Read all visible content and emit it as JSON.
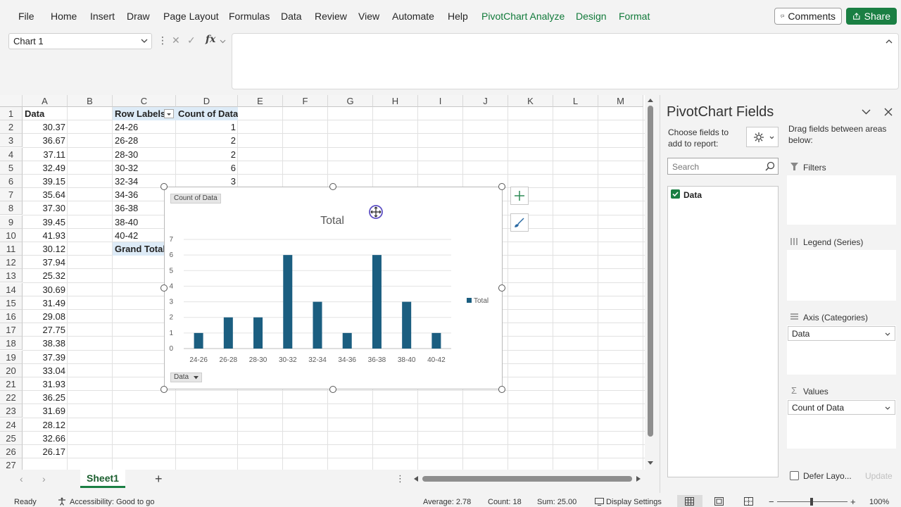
{
  "ribbon": {
    "tabs": [
      "File",
      "Home",
      "Insert",
      "Draw",
      "Page Layout",
      "Formulas",
      "Data",
      "Review",
      "View",
      "Automate",
      "Help"
    ],
    "context_tabs": [
      "PivotChart Analyze",
      "Design",
      "Format"
    ],
    "comments_label": "Comments",
    "share_label": "Share"
  },
  "formula_bar": {
    "name_box": "Chart 1",
    "fx": "fx",
    "value": ""
  },
  "grid": {
    "columns": [
      "A",
      "B",
      "C",
      "D",
      "E",
      "F",
      "G",
      "H",
      "I",
      "J",
      "K",
      "L",
      "M"
    ],
    "rows": [
      "1",
      "2",
      "3",
      "4",
      "5",
      "6",
      "7",
      "8",
      "9",
      "10",
      "11",
      "12",
      "13",
      "14",
      "15",
      "16",
      "17",
      "18",
      "19",
      "20",
      "21",
      "22",
      "23",
      "24",
      "25",
      "26",
      "27"
    ],
    "data_header": "Data",
    "data_values": [
      "30.37",
      "36.67",
      "37.11",
      "32.49",
      "39.15",
      "35.64",
      "37.30",
      "39.45",
      "41.93",
      "30.12",
      "37.94",
      "25.32",
      "30.69",
      "31.49",
      "29.08",
      "27.75",
      "38.38",
      "37.39",
      "33.04",
      "31.93",
      "36.25",
      "31.69",
      "28.12",
      "32.66",
      "26.17"
    ],
    "pivot": {
      "row_labels_header": "Row Labels",
      "count_header": "Count of Data",
      "rows": [
        {
          "label": "24-26",
          "count": "1"
        },
        {
          "label": "26-28",
          "count": "2"
        },
        {
          "label": "28-30",
          "count": "2"
        },
        {
          "label": "30-32",
          "count": "6"
        },
        {
          "label": "32-34",
          "count": "3"
        },
        {
          "label": "34-36",
          "count": ""
        },
        {
          "label": "36-38",
          "count": ""
        },
        {
          "label": "38-40",
          "count": ""
        },
        {
          "label": "40-42",
          "count": ""
        }
      ],
      "grand_total": "Grand Total"
    }
  },
  "chart_data": {
    "type": "bar",
    "title": "Total",
    "categories": [
      "24-26",
      "26-28",
      "28-30",
      "30-32",
      "32-34",
      "34-36",
      "36-38",
      "38-40",
      "40-42"
    ],
    "series": [
      {
        "name": "Total",
        "values": [
          1,
          2,
          2,
          6,
          3,
          1,
          6,
          3,
          1
        ],
        "color": "#1b5e80"
      }
    ],
    "ylim": [
      0,
      7
    ],
    "yticks": [
      "0",
      "1",
      "2",
      "3",
      "4",
      "5",
      "6",
      "7"
    ],
    "grid": true,
    "legend": "right",
    "field_button_values": "Count of Data",
    "field_button_axis": "Data"
  },
  "sheet_tabs": {
    "active": "Sheet1",
    "add": "+"
  },
  "status": {
    "ready": "Ready",
    "accessibility": "Accessibility: Good to go",
    "average": "Average: 2.78",
    "count": "Count: 18",
    "sum": "Sum: 25.00",
    "display_settings": "Display Settings",
    "zoom": "100%"
  },
  "panel": {
    "title": "PivotChart Fields",
    "choose_fields": "Choose fields to add to report:",
    "drag_hint": "Drag fields between areas below:",
    "search_placeholder": "Search",
    "fields": [
      {
        "name": "Data",
        "checked": true
      }
    ],
    "filters": "Filters",
    "legend": "Legend (Series)",
    "axis": "Axis (Categories)",
    "axis_value": "Data",
    "values": "Values",
    "values_value": "Count of Data",
    "defer_label": "Defer Layo...",
    "update_label": "Update"
  }
}
